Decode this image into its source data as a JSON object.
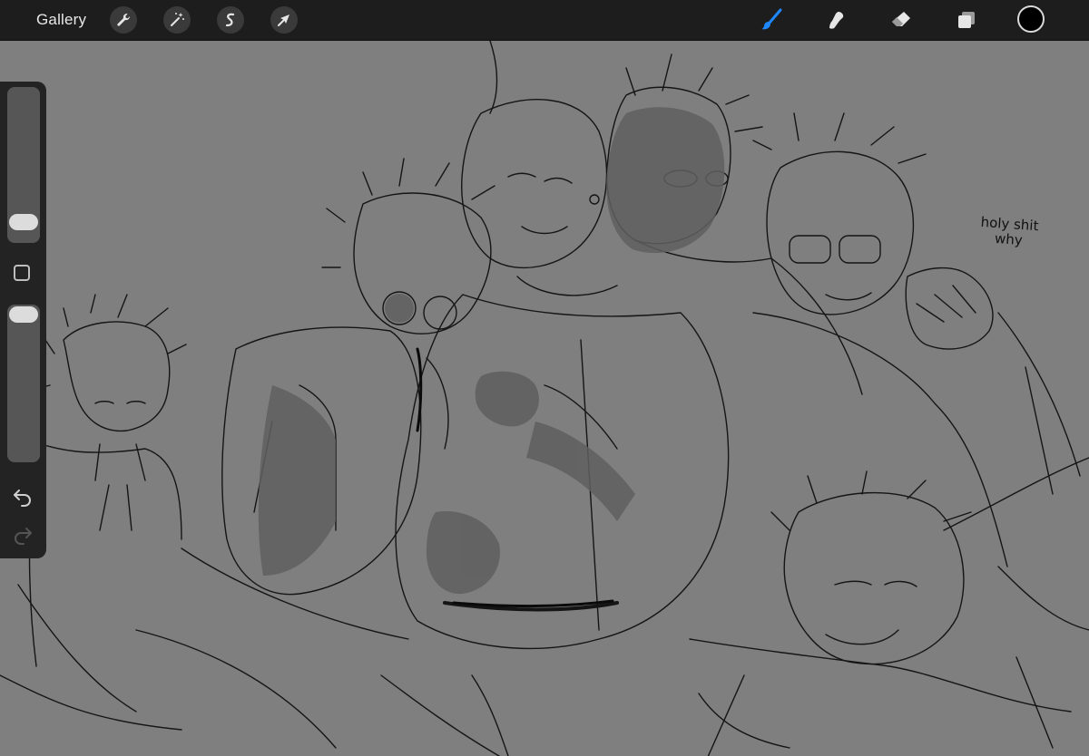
{
  "toolbar": {
    "gallery_label": "Gallery",
    "left_tools": [
      "wrench-icon",
      "magic-wand-icon",
      "selection-icon",
      "transform-arrow-icon"
    ],
    "right_tools": [
      "brush-icon",
      "smudge-icon",
      "eraser-icon",
      "layers-icon"
    ],
    "active_tool": "brush",
    "active_color": "#000000",
    "accent_color": "#1e88ff"
  },
  "sidebar": {
    "brush_size_level": 0.08,
    "opacity_level": 1.0
  },
  "canvas": {
    "background": "#7f7f7f",
    "annotation_line1": "holy shit",
    "annotation_line2": "why"
  }
}
